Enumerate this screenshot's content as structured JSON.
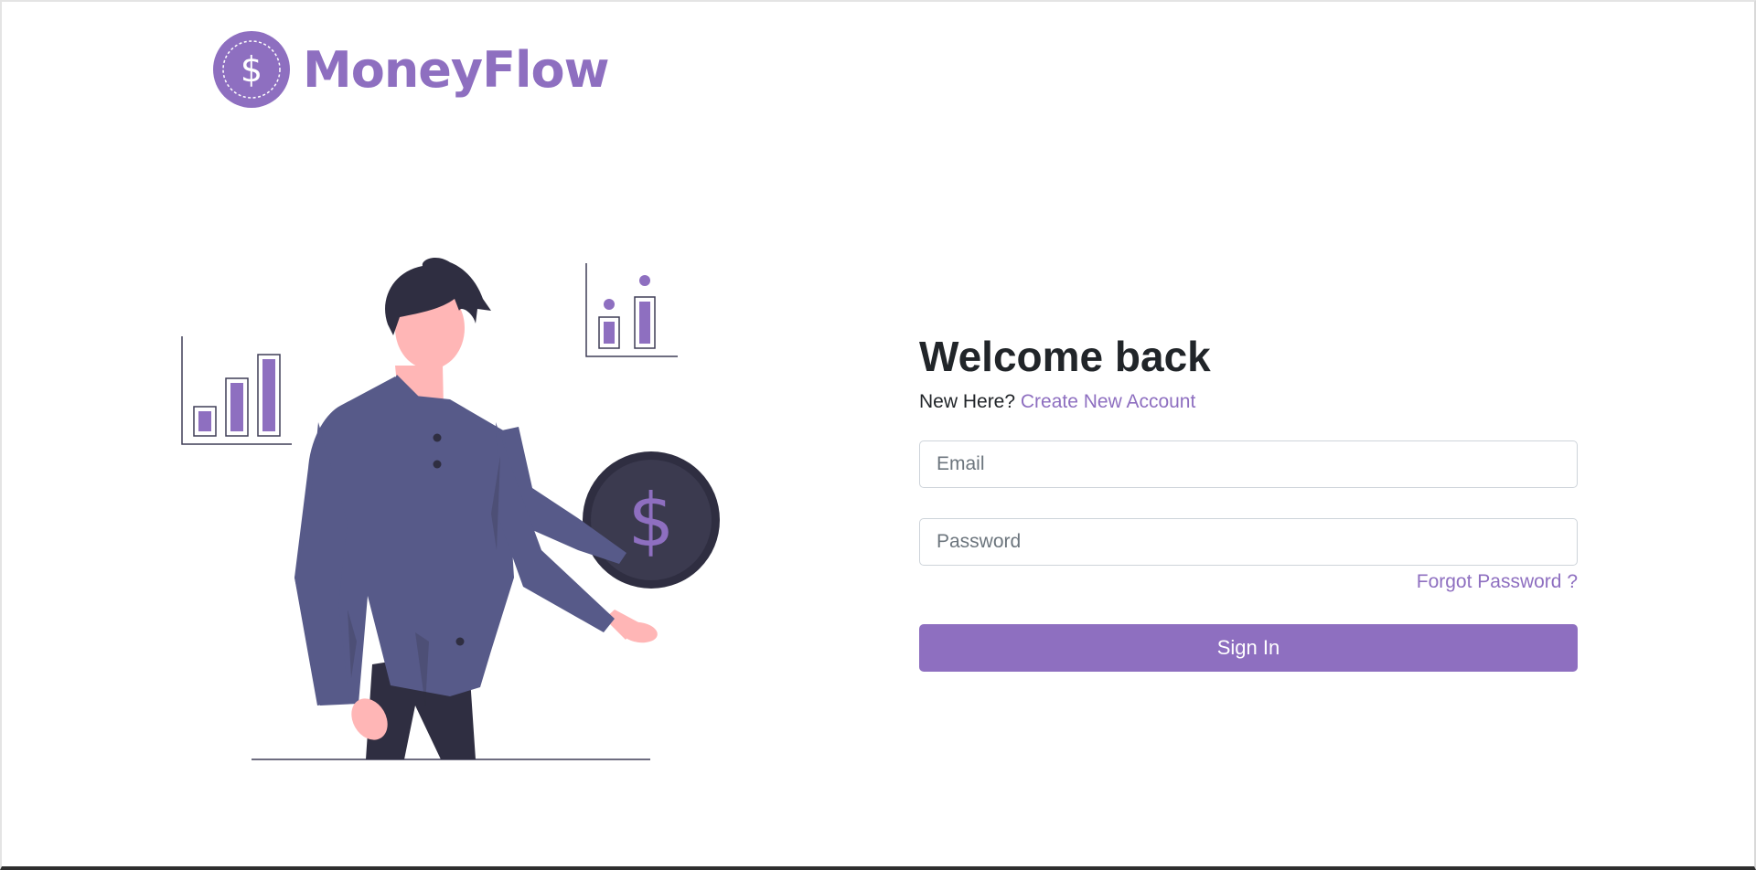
{
  "brand": {
    "name": "MoneyFlow",
    "logo_icon": "dollar-coin-icon",
    "color": "#8e6fc0"
  },
  "login": {
    "title": "Welcome back",
    "new_here_text": "New Here?",
    "create_account_label": "Create New Account",
    "email_placeholder": "Email",
    "email_value": "",
    "password_placeholder": "Password",
    "password_value": "",
    "forgot_password_label": "Forgot Password ?",
    "signin_label": "Sign In"
  },
  "illustration": {
    "icons": [
      "bar-chart-icon",
      "dot-chart-icon",
      "dollar-coin-icon",
      "person-figure"
    ]
  },
  "colors": {
    "accent": "#8e6fc0",
    "person_shirt": "#575a89",
    "dark": "#2f2e41",
    "skin": "#ffb6b6",
    "text": "#212529"
  }
}
